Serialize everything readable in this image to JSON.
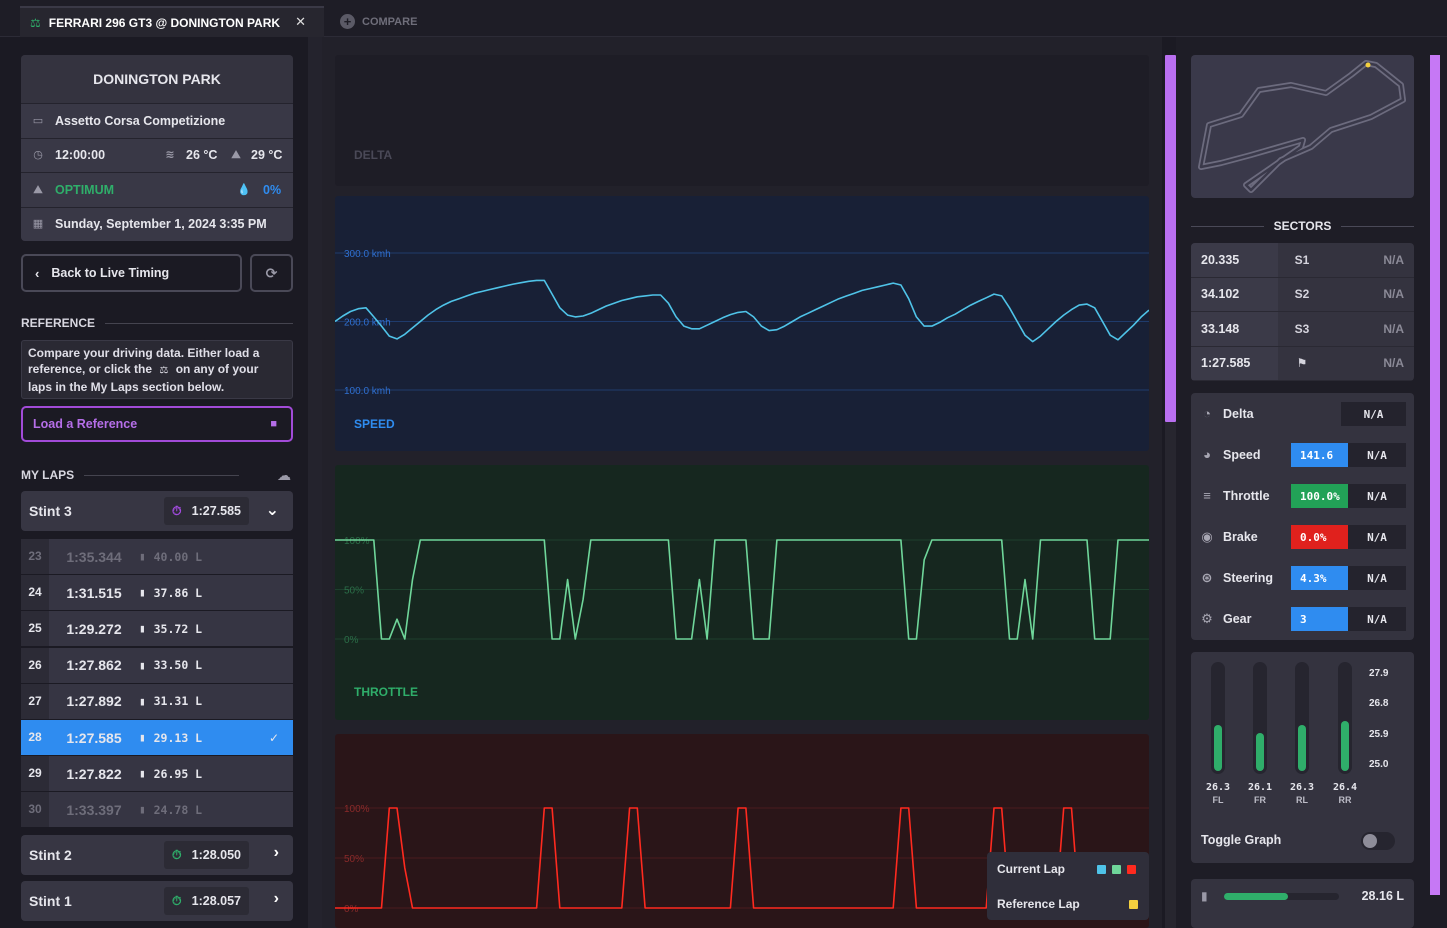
{
  "tabs": {
    "active_label": "FERRARI 296 GT3 @ DONINGTON PARK",
    "close": "✕",
    "compare_label": "COMPARE"
  },
  "session": {
    "track": "DONINGTON PARK",
    "game": "Assetto Corsa Competizione",
    "time": "12:00:00",
    "air_temp": "26 °C",
    "track_temp": "29 °C",
    "grip": "OPTIMUM",
    "wetness": "0%",
    "date": "Sunday, September 1, 2024 3:35 PM"
  },
  "nav": {
    "back_label": "Back to Live Timing"
  },
  "reference": {
    "heading": "REFERENCE",
    "help_text_1": "Compare your driving data. Either load a",
    "help_text_2a": "reference, or click the",
    "help_text_2b": "on any of your",
    "help_text_3": "laps in the My Laps section below.",
    "load_label": "Load a Reference"
  },
  "my_laps": {
    "heading": "MY LAPS",
    "stints": [
      {
        "name": "Stint 3",
        "best": "1:27.585",
        "icon_color": "#a34be0"
      },
      {
        "name": "Stint 2",
        "best": "1:28.050",
        "icon_color": "#2fae6a"
      },
      {
        "name": "Stint 1",
        "best": "1:28.057",
        "icon_color": "#2fae6a"
      }
    ],
    "laps": [
      {
        "num": "23",
        "time": "1:35.344",
        "fuel": "40.00 L"
      },
      {
        "num": "24",
        "time": "1:31.515",
        "fuel": "37.86 L"
      },
      {
        "num": "25",
        "time": "1:29.272",
        "fuel": "35.72 L"
      },
      {
        "num": "26",
        "time": "1:27.862",
        "fuel": "33.50 L"
      },
      {
        "num": "27",
        "time": "1:27.892",
        "fuel": "31.31 L"
      },
      {
        "num": "28",
        "time": "1:27.585",
        "fuel": "29.13 L"
      },
      {
        "num": "29",
        "time": "1:27.822",
        "fuel": "26.95 L"
      },
      {
        "num": "30",
        "time": "1:33.397",
        "fuel": "24.78 L"
      }
    ],
    "selected_lap": "28"
  },
  "charts": {
    "delta_label": "DELTA",
    "speed_label": "SPEED",
    "throttle_label": "THROTTLE",
    "colors": {
      "speed": "#4fc3e8",
      "throttle": "#6fd69a",
      "brake": "#ff2a1f"
    }
  },
  "chart_data": [
    {
      "type": "line",
      "title": "SPEED",
      "yticks": [
        "300.0 kmh",
        "200.0 kmh",
        "100.0 kmh"
      ],
      "ylim": [
        0,
        300
      ],
      "series": [
        {
          "values": [
            150,
            162,
            172,
            178,
            180,
            160,
            140,
            118,
            112,
            122,
            136,
            150,
            164,
            176,
            186,
            194,
            200,
            206,
            212,
            216,
            220,
            224,
            228,
            232,
            235,
            238,
            240,
            240,
            210,
            180,
            164,
            160,
            162,
            168,
            176,
            184,
            190,
            196,
            200,
            204,
            206,
            208,
            208,
            190,
            160,
            140,
            134,
            134,
            142,
            150,
            158,
            165,
            170,
            172,
            160,
            140,
            130,
            132,
            140,
            150,
            160,
            168,
            176,
            184,
            192,
            200,
            206,
            212,
            218,
            222,
            226,
            230,
            234,
            230,
            200,
            160,
            140,
            140,
            148,
            158,
            166,
            176,
            186,
            194,
            202,
            210,
            206,
            180,
            150,
            120,
            106,
            118,
            134,
            150,
            164,
            176,
            186,
            188,
            180,
            150,
            120,
            110,
            126,
            142,
            160,
            175
          ]
        }
      ]
    },
    {
      "type": "line",
      "title": "THROTTLE",
      "yticks": [
        "100%",
        "50%",
        "0%"
      ],
      "ylim": [
        0,
        100
      ],
      "series": [
        {
          "values": [
            100,
            100,
            100,
            100,
            100,
            100,
            0,
            0,
            20,
            0,
            60,
            100,
            100,
            100,
            100,
            100,
            100,
            100,
            100,
            100,
            100,
            100,
            100,
            100,
            100,
            100,
            100,
            100,
            0,
            0,
            60,
            0,
            40,
            100,
            100,
            100,
            100,
            100,
            100,
            100,
            100,
            100,
            100,
            100,
            0,
            0,
            0,
            60,
            0,
            100,
            100,
            100,
            100,
            100,
            0,
            0,
            0,
            100,
            100,
            100,
            100,
            100,
            100,
            100,
            100,
            100,
            100,
            100,
            100,
            100,
            100,
            100,
            100,
            100,
            0,
            0,
            80,
            100,
            100,
            100,
            100,
            100,
            100,
            100,
            100,
            100,
            100,
            0,
            0,
            60,
            0,
            100,
            100,
            100,
            100,
            100,
            100,
            100,
            0,
            0,
            0,
            100,
            100,
            100,
            100,
            100
          ]
        }
      ]
    },
    {
      "type": "line",
      "title": "",
      "yticks": [
        "100%",
        "50%",
        "0%"
      ],
      "ylim": [
        0,
        100
      ],
      "series": [
        {
          "values": [
            0,
            0,
            0,
            0,
            0,
            0,
            0,
            100,
            100,
            40,
            0,
            0,
            0,
            0,
            0,
            0,
            0,
            0,
            0,
            0,
            0,
            0,
            0,
            0,
            0,
            0,
            0,
            100,
            100,
            0,
            0,
            0,
            0,
            0,
            0,
            0,
            0,
            0,
            100,
            100,
            0,
            0,
            0,
            0,
            0,
            0,
            0,
            0,
            0,
            0,
            0,
            0,
            100,
            100,
            0,
            0,
            0,
            0,
            0,
            0,
            0,
            0,
            0,
            0,
            0,
            0,
            0,
            0,
            0,
            0,
            0,
            0,
            0,
            100,
            100,
            0,
            0,
            0,
            0,
            0,
            0,
            0,
            0,
            0,
            0,
            100,
            100,
            0,
            0,
            0,
            0,
            0,
            0,
            0,
            100,
            100,
            0,
            0,
            0,
            0,
            0,
            0,
            0,
            0,
            0,
            0
          ]
        }
      ]
    }
  ],
  "legend": {
    "current": "Current Lap",
    "reference": "Reference Lap",
    "current_colors": [
      "#4fc3e8",
      "#6fd69a",
      "#ff2a1f"
    ],
    "reference_color": "#f4d03f"
  },
  "sectors": {
    "heading": "SECTORS",
    "rows": [
      {
        "time": "20.335",
        "name": "S1",
        "ref": "N/A"
      },
      {
        "time": "34.102",
        "name": "S2",
        "ref": "N/A"
      },
      {
        "time": "33.148",
        "name": "S3",
        "ref": "N/A"
      },
      {
        "time": "1:27.585",
        "name": "",
        "ref": "N/A"
      }
    ]
  },
  "metrics": [
    {
      "label": "Delta",
      "value": "",
      "ref": "N/A",
      "color": ""
    },
    {
      "label": "Speed",
      "value": "141.6",
      "ref": "N/A",
      "color": "#2f8cf0"
    },
    {
      "label": "Throttle",
      "value": "100.0%",
      "ref": "N/A",
      "color": "#22a257"
    },
    {
      "label": "Brake",
      "value": "0.0%",
      "ref": "N/A",
      "color": "#e0211d"
    },
    {
      "label": "Steering",
      "value": "4.3%",
      "ref": "N/A",
      "color": "#2f8cf0"
    },
    {
      "label": "Gear",
      "value": "3",
      "ref": "N/A",
      "color": "#2f8cf0"
    }
  ],
  "tires": {
    "items": [
      {
        "pos": "FL",
        "pressure": "26.3",
        "level": 0.43
      },
      {
        "pos": "FR",
        "pressure": "26.1",
        "level": 0.36
      },
      {
        "pos": "RL",
        "pressure": "26.3",
        "level": 0.43
      },
      {
        "pos": "RR",
        "pressure": "26.4",
        "level": 0.47
      }
    ],
    "scale": [
      "27.9",
      "26.8",
      "25.9",
      "25.0"
    ],
    "toggle_label": "Toggle Graph"
  },
  "fuel": {
    "value": "28.16 L",
    "level": 0.58
  }
}
